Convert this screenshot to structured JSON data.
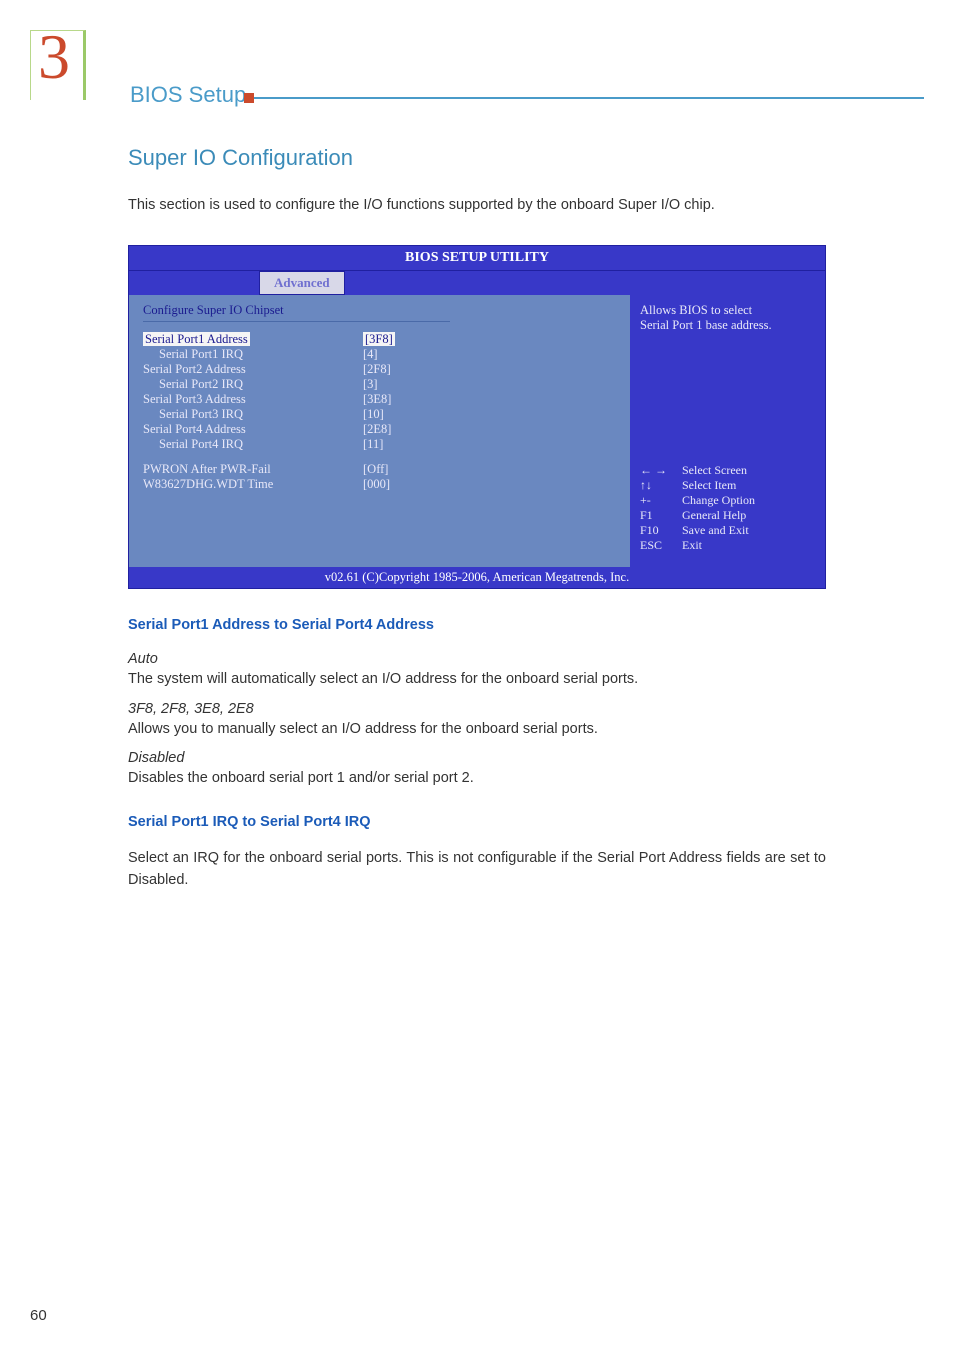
{
  "header": {
    "chapter_number": "3",
    "title": "BIOS Setup"
  },
  "section": {
    "title": "Super IO Configuration",
    "intro": "This section is used to configure the I/O functions supported by the onboard Super I/O chip."
  },
  "bios": {
    "utility_title": "BIOS SETUP UTILITY",
    "tab": "Advanced",
    "chipset_header": "Configure Super IO Chipset",
    "items": [
      {
        "label": "Serial Port1 Address",
        "value": "[3F8]",
        "indent": false,
        "selected": true
      },
      {
        "label": "Serial Port1 IRQ",
        "value": "[4]",
        "indent": true,
        "selected": false
      },
      {
        "label": "Serial Port2 Address",
        "value": "[2F8]",
        "indent": false,
        "selected": false
      },
      {
        "label": "Serial Port2 IRQ",
        "value": "[3]",
        "indent": true,
        "selected": false
      },
      {
        "label": "Serial Port3 Address",
        "value": "[3E8]",
        "indent": false,
        "selected": false
      },
      {
        "label": "Serial Port3 IRQ",
        "value": "[10]",
        "indent": true,
        "selected": false
      },
      {
        "label": "Serial Port4 Address",
        "value": "[2E8]",
        "indent": false,
        "selected": false
      },
      {
        "label": "Serial Port4 IRQ",
        "value": "[11]",
        "indent": true,
        "selected": false
      }
    ],
    "extra_items": [
      {
        "label": "PWRON After PWR-Fail",
        "value": "[Off]"
      },
      {
        "label": "W83627DHG.WDT Time",
        "value": "[000]"
      }
    ],
    "help_text_line1": "Allows BIOS to select",
    "help_text_line2": "Serial Port 1 base address.",
    "nav": [
      {
        "key": "← →",
        "desc": "Select Screen"
      },
      {
        "key": "↑↓",
        "desc": "Select Item"
      },
      {
        "key": "+-",
        "desc": "Change Option"
      },
      {
        "key": "F1",
        "desc": "General Help"
      },
      {
        "key": "F10",
        "desc": "Save and Exit"
      },
      {
        "key": "ESC",
        "desc": "Exit"
      }
    ],
    "footer": "v02.61 (C)Copyright 1985-2006, American Megatrends, Inc."
  },
  "subsections": [
    {
      "title": "Serial Port1 Address to Serial Port4 Address",
      "params": [
        {
          "label": "Auto",
          "desc": "The system will automatically select an I/O address for the onboard serial ports."
        },
        {
          "label": "3F8, 2F8, 3E8, 2E8",
          "desc": "Allows you to manually select an I/O address for the onboard serial ports."
        },
        {
          "label": "Disabled",
          "desc": "Disables the onboard serial port 1 and/or serial port 2."
        }
      ]
    },
    {
      "title": "Serial Port1 IRQ to Serial Port4 IRQ",
      "params": [
        {
          "label": "",
          "desc": "Select an IRQ for the onboard serial ports. This is not configurable if the Serial Port Address fields are set to Disabled."
        }
      ]
    }
  ],
  "page_number": "60"
}
